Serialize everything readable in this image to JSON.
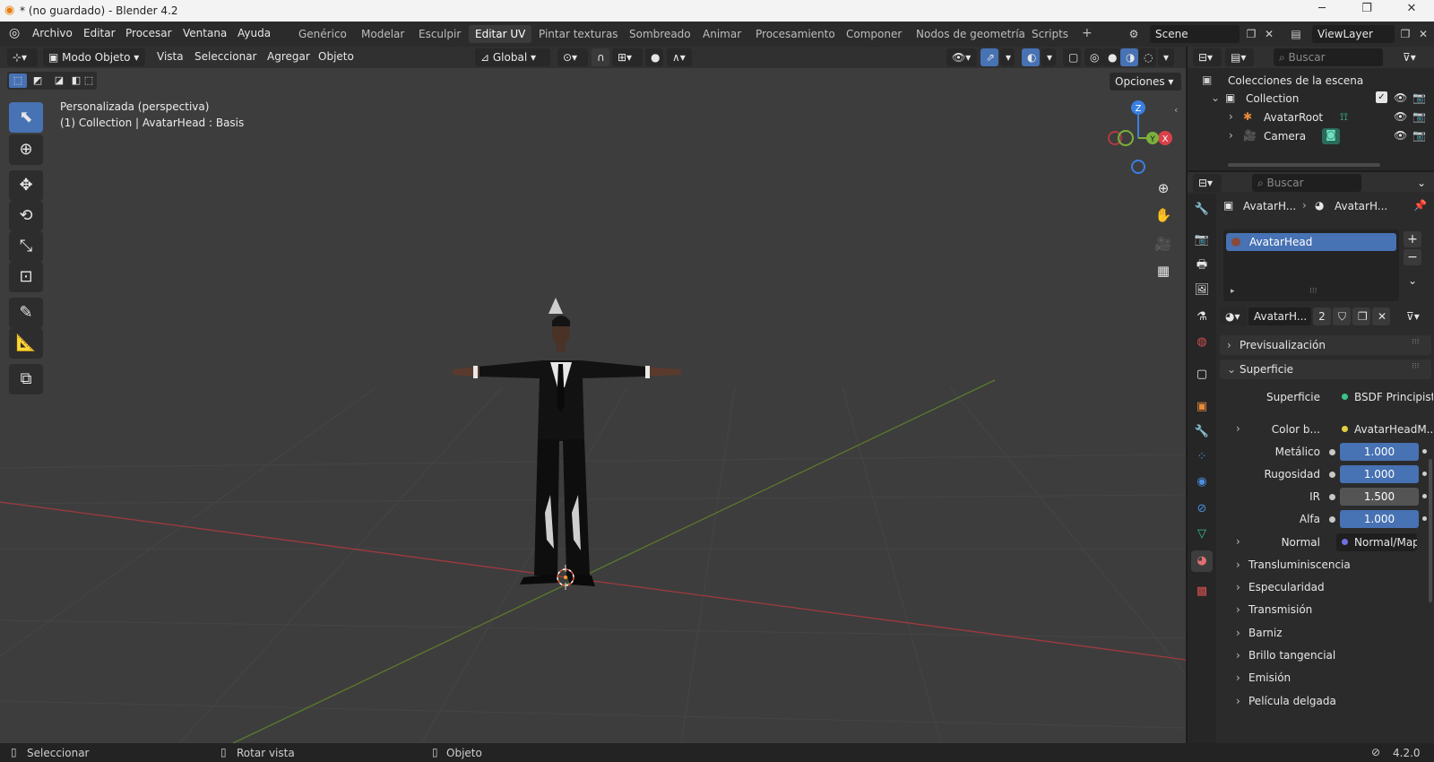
{
  "titlebar": {
    "title": "* (no guardado) - Blender 4.2",
    "minimize": "─",
    "maximize": "❐",
    "close": "✕"
  },
  "menubar": {
    "menus": [
      "Archivo",
      "Editar",
      "Procesar",
      "Ventana",
      "Ayuda"
    ],
    "workspaces": [
      "Genérico",
      "Modelar",
      "Esculpir",
      "Editar UV",
      "Pintar texturas",
      "Sombreado",
      "Animar",
      "Procesamiento",
      "Componer",
      "Nodos de geometría",
      "Scripts"
    ],
    "active_workspace": "Editar UV",
    "add_workspace": "+",
    "scene": "Scene",
    "view_layer": "ViewLayer"
  },
  "viewport": {
    "mode": "Modo Objeto",
    "menus": [
      "Vista",
      "Seleccionar",
      "Agregar",
      "Objeto"
    ],
    "transform_orientation": "Global",
    "options": "Opciones",
    "info_line1": "Personalizada (perspectiva)",
    "info_line2": "(1) Collection | AvatarHead : Basis",
    "gizmo": {
      "z": "Z",
      "y": "Y",
      "x": "X"
    },
    "colors": {
      "x_axis": "#d8404a",
      "y_axis": "#7ab03b",
      "z_axis": "#3a7fe0",
      "grid_bg": "#3d3d3d"
    }
  },
  "outliner": {
    "search_placeholder": "Buscar",
    "scene_collection": "Colecciones de la escena",
    "items": [
      {
        "name": "Collection"
      },
      {
        "name": "AvatarRoot"
      },
      {
        "name": "Camera"
      }
    ]
  },
  "properties": {
    "search_placeholder": "Buscar",
    "breadcrumb_object": "AvatarH...",
    "breadcrumb_material": "AvatarH...",
    "material_slot": "AvatarHead",
    "material_name": "AvatarH...",
    "user_count": "2",
    "sections": {
      "preview": "Previsualización",
      "surface": "Superficie"
    },
    "surface_label": "Superficie",
    "surface_shader": "BSDF Principista",
    "base_color_label": "Color b...",
    "base_color_link": "AvatarHeadM...",
    "metallic_label": "Metálico",
    "metallic": "1.000",
    "roughness_label": "Rugosidad",
    "roughness": "1.000",
    "ior_label": "IR",
    "ior": "1.500",
    "alpha_label": "Alfa",
    "alpha": "1.000",
    "normal_label": "Normal",
    "normal_link": "Normal/Map",
    "subpanels": [
      "Transluminiscencia",
      "Especularidad",
      "Transmisión",
      "Barniz",
      "Brillo tangencial",
      "Emisión",
      "Película delgada"
    ]
  },
  "statusbar": {
    "select": "Seleccionar",
    "rotate": "Rotar vista",
    "object": "Objeto",
    "version": "4.2.0"
  }
}
